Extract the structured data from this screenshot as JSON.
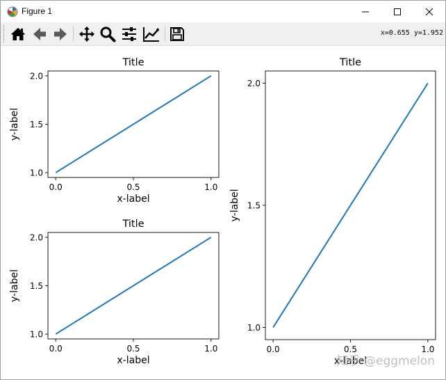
{
  "window": {
    "title": "Figure 1",
    "icons": [
      "matplotlib-logo-icon",
      "minimize-icon",
      "maximize-icon",
      "close-icon"
    ]
  },
  "toolbar": {
    "buttons": [
      "home-icon",
      "back-arrow-icon",
      "forward-arrow-icon",
      "pan-move-icon",
      "zoom-magnifier-icon",
      "subplots-sliders-icon",
      "edit-axis-curve-icon",
      "save-floppy-icon"
    ],
    "coords": "x=0.655 y=1.952"
  },
  "colors": {
    "line": "#1f77b4",
    "toolbar_bg": "#f0f0f0"
  },
  "watermark": "知乎 @eggmelon",
  "chart_data": [
    {
      "type": "line",
      "title": "Title",
      "xlabel": "x-label",
      "ylabel": "y-label",
      "x": [
        0.0,
        1.0
      ],
      "series": [
        {
          "values": [
            1.0,
            2.0
          ]
        }
      ],
      "xlim": [
        -0.05,
        1.05
      ],
      "ylim": [
        0.95,
        2.05
      ],
      "xticks": [
        "0.0",
        "0.5",
        "1.0"
      ],
      "yticks": [
        "1.0",
        "1.5",
        "2.0"
      ],
      "grid": false
    },
    {
      "type": "line",
      "title": "Title",
      "xlabel": "x-label",
      "ylabel": "y-label",
      "x": [
        0.0,
        1.0
      ],
      "series": [
        {
          "values": [
            1.0,
            2.0
          ]
        }
      ],
      "xlim": [
        -0.05,
        1.05
      ],
      "ylim": [
        0.95,
        2.05
      ],
      "xticks": [
        "0.0",
        "0.5",
        "1.0"
      ],
      "yticks": [
        "1.0",
        "1.5",
        "2.0"
      ],
      "grid": false
    },
    {
      "type": "line",
      "title": "Title",
      "xlabel": "x-label",
      "ylabel": "y-label",
      "x": [
        0.0,
        1.0
      ],
      "series": [
        {
          "values": [
            1.0,
            2.0
          ]
        }
      ],
      "xlim": [
        -0.05,
        1.05
      ],
      "ylim": [
        0.95,
        2.05
      ],
      "xticks": [
        "0.0",
        "0.5",
        "1.0"
      ],
      "yticks": [
        "1.0",
        "1.5",
        "2.0"
      ],
      "grid": false
    }
  ]
}
